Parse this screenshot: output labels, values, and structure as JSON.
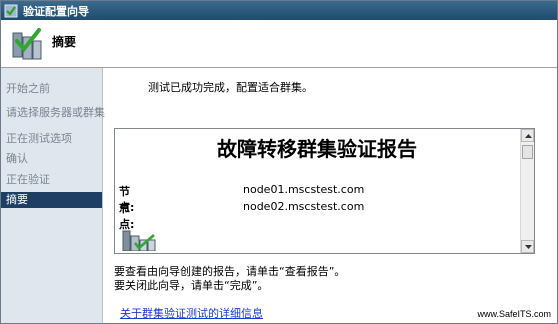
{
  "window": {
    "title": "验证配置向导"
  },
  "header": {
    "title": "摘要",
    "icon": "cluster-validation-icon"
  },
  "sidebar": {
    "items": [
      {
        "label": "开始之前",
        "active": false
      },
      {
        "label": "请选择服务器或群集",
        "active": false
      },
      {
        "label": "正在测试选项",
        "active": false
      },
      {
        "label": "确认",
        "active": false
      },
      {
        "label": "正在验证",
        "active": false
      },
      {
        "label": "摘要",
        "active": true
      }
    ]
  },
  "main": {
    "message": "测试已成功完成，配置适合群集。",
    "report": {
      "title": "故障转移群集验证报告",
      "nodes": [
        {
          "label": "节点:",
          "value": "node01.mscstest.com"
        },
        {
          "label": "节点:",
          "value": "node02.mscstest.com"
        }
      ]
    },
    "hint_view": "要查看由向导创建的报告，请单击“查看报告”。",
    "hint_close": "要关闭此向导，请单击“完成”。",
    "link": "关于群集验证测试的详细信息"
  },
  "watermark": "www.SafeITS.com",
  "colors": {
    "titlebar": "#1f4c6e",
    "sidebar": "#dfe6ee",
    "sidebar_active": "#1e3f63",
    "link": "#1a39d6"
  }
}
